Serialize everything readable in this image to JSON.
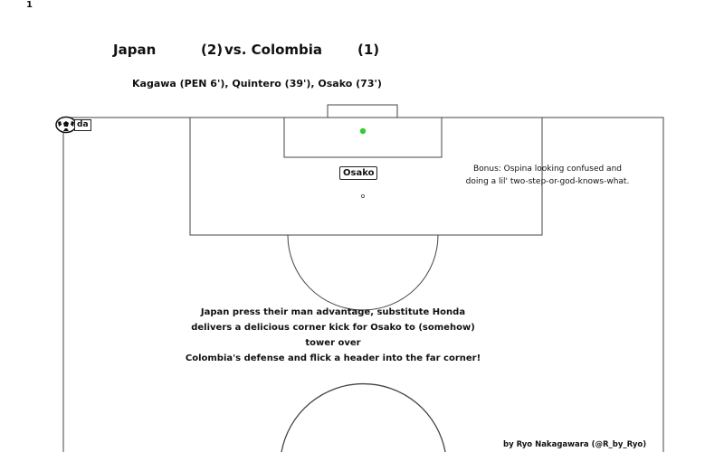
{
  "frame": {
    "number": "1"
  },
  "match": {
    "home_team": "Japan",
    "home_score": "(2)",
    "vs_away": "vs. Colombia",
    "away_score": "(1)",
    "scorers": "Kagawa (PEN 6'), Quintero (39'), Osako (73')"
  },
  "annotations": {
    "bonus_line1": "Bonus: Ospina looking confused and",
    "bonus_line2": "doing a lil' two-step-or-god-knows-what.",
    "desc_line1": "Japan press their man advantage, substitute Honda",
    "desc_line2": "delivers a delicious corner kick for Osako to (somehow) tower over",
    "desc_line3": "Colombia's defense and flick a header into the far corner!",
    "credit": "by Ryo Nakagawara (@R_by_Ryo)"
  },
  "players": {
    "osako_label": "Osako",
    "ball_carrier_label": "da"
  },
  "colors": {
    "pitch_line": "#444444",
    "ball_marker": "#33cc33",
    "background": "#ffffff"
  },
  "icons": {
    "ball": "soccer-ball-icon"
  }
}
